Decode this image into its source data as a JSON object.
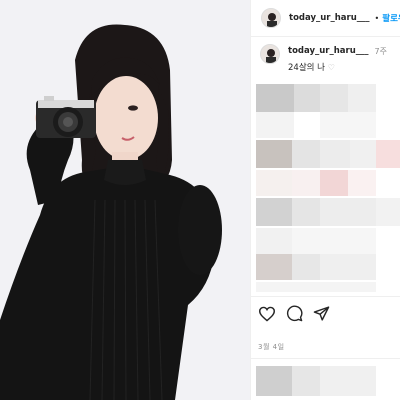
{
  "post": {
    "username": "today_ur_haru___",
    "follow_label": "팔로우",
    "dot": "•"
  },
  "caption": {
    "username": "today_ur_haru___",
    "time": "7주",
    "text": "24살의 나",
    "heart": "♡"
  },
  "actions": {
    "like": "heart-icon",
    "comment": "comment-icon",
    "share": "share-icon"
  },
  "date": "3월 4일",
  "colors": {
    "accent": "#0095f6",
    "text": "#262626",
    "muted": "#8e8e8e"
  }
}
